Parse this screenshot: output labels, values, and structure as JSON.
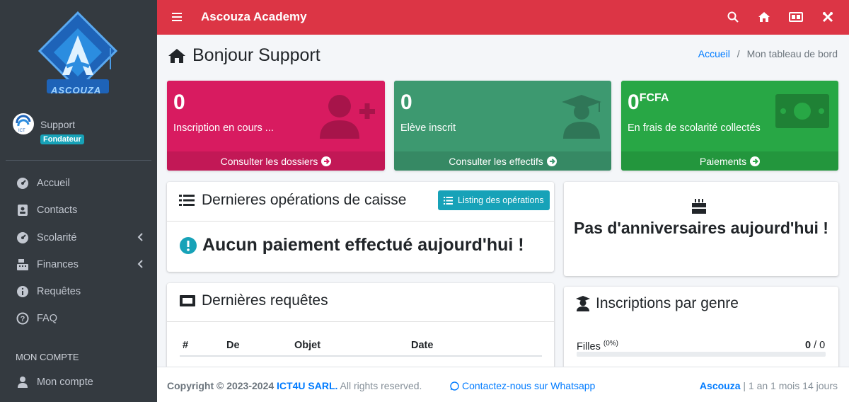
{
  "sidebar": {
    "brand_text": "ASCOUZA",
    "user": {
      "name": "Support",
      "role": "Fondateur"
    },
    "items": [
      {
        "label": "Accueil"
      },
      {
        "label": "Contacts"
      },
      {
        "label": "Scolarité"
      },
      {
        "label": "Finances"
      },
      {
        "label": "Requêtes"
      },
      {
        "label": "FAQ"
      }
    ],
    "section_header": "MON COMPTE",
    "account_item": "Mon compte"
  },
  "topbar": {
    "title": "Ascouza Academy",
    "icons": [
      "menu-icon",
      "search-icon",
      "home-icon",
      "id-card-icon",
      "tools-icon"
    ]
  },
  "header": {
    "title": "Bonjour Support",
    "breadcrumb": {
      "home": "Accueil",
      "separator": "/",
      "current": "Mon tableau de bord"
    }
  },
  "stats": [
    {
      "value": "0",
      "unit": "",
      "label": "Inscription en cours ...",
      "link": "Consulter les dossiers",
      "color": "#d81b60"
    },
    {
      "value": "0",
      "unit": "",
      "label": "Elève inscrit",
      "link": "Consulter les effectifs",
      "color": "#3d9970"
    },
    {
      "value": "0",
      "unit": "FCFA",
      "label": "En frais de scolarité collectés",
      "link": "Paiements",
      "color": "#28a745"
    }
  ],
  "cash": {
    "title": "Dernieres opérations de caisse",
    "button": "Listing des opérations",
    "message": "Aucun paiement effectué aujourd'hui !"
  },
  "birthday": {
    "message": "Pas d'anniversaires aujourd'hui !"
  },
  "requests": {
    "title": "Dernières requêtes",
    "columns": [
      "#",
      "De",
      "Objet",
      "Date"
    ]
  },
  "gender": {
    "title": "Inscriptions par genre",
    "rows": [
      {
        "label": "Filles",
        "percent": "(0%)",
        "count": "0",
        "total": "/ 0"
      }
    ]
  },
  "footer": {
    "copyright": "Copyright © 2023-2024",
    "company": "ICT4U SARL.",
    "rights": "All rights reserved.",
    "contact": "Contactez-nous sur Whatsapp",
    "brand": "Ascouza",
    "sep": "|",
    "duration": "1 an 1 mois 14 jours"
  },
  "colors": {
    "topbar": "#dc3545",
    "sidebar": "#343a40",
    "info": "#17a2b8",
    "link": "#007bff"
  }
}
